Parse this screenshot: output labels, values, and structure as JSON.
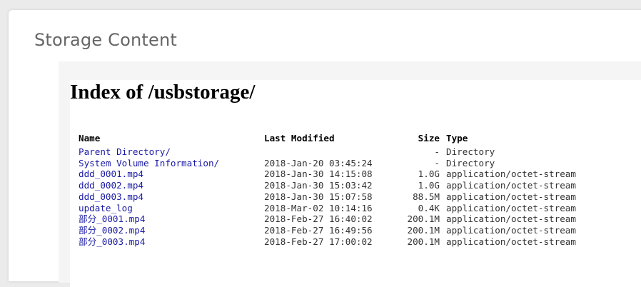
{
  "section_title": "Storage Content",
  "index_title": "Index of /usbstorage/",
  "columns": {
    "name": "Name",
    "modified": "Last Modified",
    "size": "Size",
    "type": "Type"
  },
  "rows": [
    {
      "name": "Parent Directory/",
      "modified": "",
      "size": "-",
      "type": "Directory"
    },
    {
      "name": "System Volume Information/",
      "modified": "2018-Jan-20 03:45:24",
      "size": "-",
      "type": "Directory"
    },
    {
      "name": "ddd_0001.mp4",
      "modified": "2018-Jan-30 14:15:08",
      "size": "1.0G",
      "type": "application/octet-stream"
    },
    {
      "name": "ddd_0002.mp4",
      "modified": "2018-Jan-30 15:03:42",
      "size": "1.0G",
      "type": "application/octet-stream"
    },
    {
      "name": "ddd_0003.mp4",
      "modified": "2018-Jan-30 15:07:58",
      "size": "88.5M",
      "type": "application/octet-stream"
    },
    {
      "name": "update_log",
      "modified": "2018-Mar-02 10:14:16",
      "size": "0.4K",
      "type": "application/octet-stream"
    },
    {
      "name": "部分_0001.mp4",
      "modified": "2018-Feb-27 16:40:02",
      "size": "200.1M",
      "type": "application/octet-stream"
    },
    {
      "name": "部分_0002.mp4",
      "modified": "2018-Feb-27 16:49:56",
      "size": "200.1M",
      "type": "application/octet-stream"
    },
    {
      "name": "部分_0003.mp4",
      "modified": "2018-Feb-27 17:00:02",
      "size": "200.1M",
      "type": "application/octet-stream"
    }
  ]
}
